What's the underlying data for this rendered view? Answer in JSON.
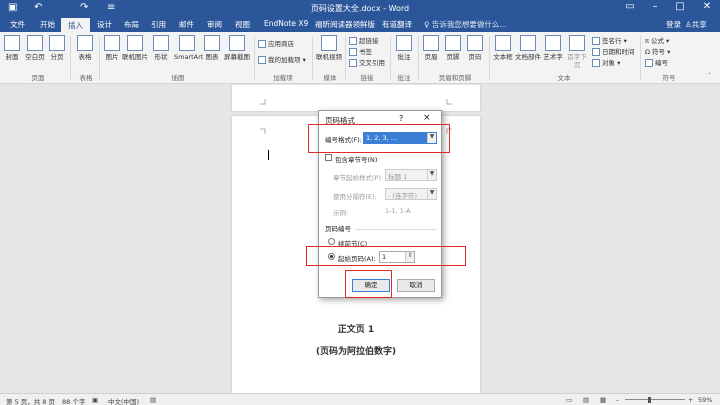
{
  "window": {
    "title": "页码设置大全.docx - Word",
    "qa_icons": [
      "save-icon",
      "undo-icon",
      "redo-icon",
      "customize-icon"
    ],
    "controls": [
      "ribbon-display-icon",
      "minimize-icon",
      "maximize-icon",
      "close-icon"
    ]
  },
  "tabs": [
    "文件",
    "开始",
    "插入",
    "设计",
    "布局",
    "引用",
    "邮件",
    "审阅",
    "视图",
    "EndNote X9",
    "福昕阅读器领鲜版",
    "有道翻译"
  ],
  "active_tab": "插入",
  "search_placeholder": "告诉我您想要做什么...",
  "login": "登录",
  "share": "共享",
  "ribbon": {
    "buttons": [
      {
        "label": "封面"
      },
      {
        "label": "空白页"
      },
      {
        "label": "分页"
      },
      {
        "label": "表格"
      },
      {
        "label": "图片"
      },
      {
        "label": "联机图片"
      },
      {
        "label": "形状"
      },
      {
        "label": "SmartArt"
      },
      {
        "label": "图表"
      },
      {
        "label": "屏幕截图"
      },
      {
        "label": "联机视频"
      },
      {
        "label": "批注"
      },
      {
        "label": "页眉"
      },
      {
        "label": "页脚"
      },
      {
        "label": "页码"
      },
      {
        "label": "文本框"
      },
      {
        "label": "文档部件"
      },
      {
        "label": "艺术字"
      },
      {
        "label": "首字下沉"
      }
    ],
    "small": {
      "store": "应用商店",
      "addins": "我的加载项",
      "hyperlink": "超链接",
      "bookmark": "书签",
      "crossref": "交叉引用",
      "sigline": "签名行",
      "datetime": "日期和时间",
      "object": "对象",
      "equation": "公式",
      "symbol": "符号",
      "number": "编号"
    },
    "groups": [
      "页面",
      "表格",
      "插图",
      "加载项",
      "媒体",
      "链接",
      "批注",
      "页眉和页脚",
      "文本",
      "符号"
    ]
  },
  "dialog": {
    "title": "页码格式",
    "help": "?",
    "close": "×",
    "number_format_label": "编号格式(F):",
    "number_format_value": "1, 2, 3, ...",
    "include_chapter": "包含章节号(N)",
    "chapter_style_label": "章节起始样式(P)",
    "chapter_style_value": "标题 1",
    "separator_label": "使用分隔符(E):",
    "separator_value": "- (连字符)",
    "example_label": "示例:",
    "example_value": "1-1, 1-A",
    "page_numbering": "页码编号",
    "continue": "续前节(C)",
    "start_at": "起始页码(A):",
    "start_value": "1",
    "ok": "确定",
    "cancel": "取消"
  },
  "document": {
    "line1": "正文页 1",
    "line2": "(页码为阿拉伯数字)"
  },
  "status": {
    "page": "第 5 页，共 8 页",
    "words": "88 个字",
    "lang": "中文(中国)",
    "zoom": "59%"
  }
}
